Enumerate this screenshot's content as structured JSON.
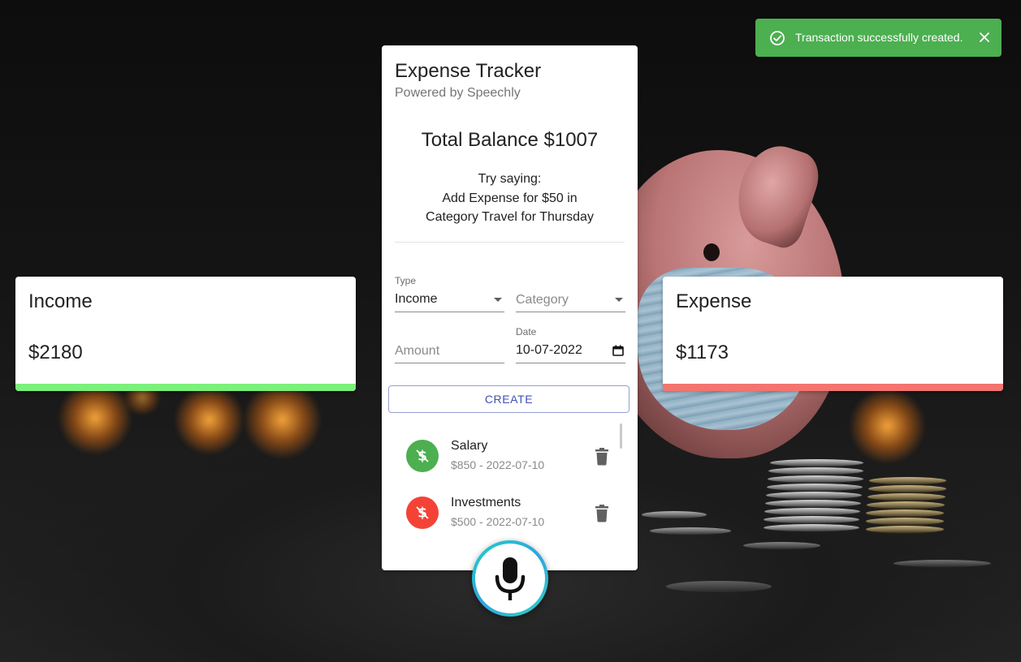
{
  "toast": {
    "message": "Transaction successfully created.",
    "color": "#4caf50"
  },
  "income_card": {
    "title": "Income",
    "amount": "$2180",
    "accent": "#7bf07a"
  },
  "expense_card": {
    "title": "Expense",
    "amount": "$1173",
    "accent": "#f4746f"
  },
  "tracker": {
    "title": "Expense Tracker",
    "subtitle": "Powered by Speechly",
    "balance": "Total Balance $1007",
    "hint": {
      "line1": "Try saying:",
      "line2": "Add Expense for $50 in",
      "line3": "Category Travel for Thursday"
    },
    "form": {
      "type_label": "Type",
      "type_value": "Income",
      "category_placeholder": "Category",
      "amount_placeholder": "Amount",
      "date_label": "Date",
      "date_value": "10-07-2022",
      "create_label": "CREATE"
    },
    "transactions": [
      {
        "name": "Salary",
        "detail": "$850 - 2022-07-10",
        "kind": "income",
        "color": "#4caf50",
        "icon": "dollar-icon"
      },
      {
        "name": "Investments",
        "detail": "$500 - 2022-07-10",
        "kind": "income",
        "color": "#f44336",
        "icon": "dollar-icon"
      }
    ]
  },
  "mic": {
    "icon": "microphone-icon"
  }
}
